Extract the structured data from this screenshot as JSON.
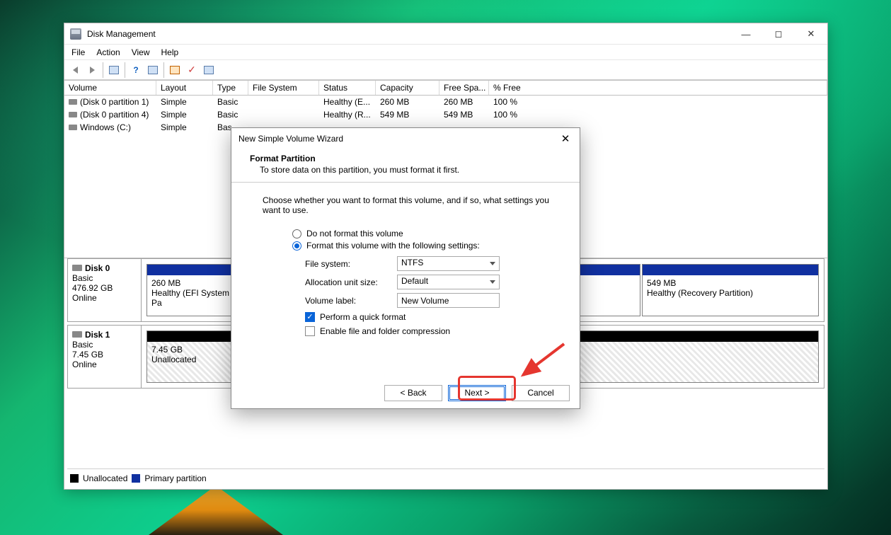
{
  "window": {
    "title": "Disk Management",
    "menu": [
      "File",
      "Action",
      "View",
      "Help"
    ]
  },
  "columns": {
    "c0": "Volume",
    "c1": "Layout",
    "c2": "Type",
    "c3": "File System",
    "c4": "Status",
    "c5": "Capacity",
    "c6": "Free Spa...",
    "c7": "% Free"
  },
  "rows": [
    {
      "vol": "(Disk 0 partition 1)",
      "lay": "Simple",
      "typ": "Basic",
      "fs": "",
      "stat": "Healthy (E...",
      "cap": "260 MB",
      "free": "260 MB",
      "pct": "100 %"
    },
    {
      "vol": "(Disk 0 partition 4)",
      "lay": "Simple",
      "typ": "Basic",
      "fs": "",
      "stat": "Healthy (R...",
      "cap": "549 MB",
      "free": "549 MB",
      "pct": "100 %"
    },
    {
      "vol": "Windows (C:)",
      "lay": "Simple",
      "typ": "Bas",
      "fs": "",
      "stat": "",
      "cap": "",
      "free": "",
      "pct": ""
    }
  ],
  "disk0": {
    "name": "Disk 0",
    "type": "Basic",
    "size": "476.92 GB",
    "status": "Online",
    "p1": {
      "size": "260 MB",
      "stat": "Healthy (EFI System Pa"
    },
    "p4": {
      "size": "549 MB",
      "stat": "Healthy (Recovery Partition)"
    }
  },
  "disk1": {
    "name": "Disk 1",
    "type": "Basic",
    "size": "7.45 GB",
    "status": "Online",
    "p1": {
      "size": "7.45 GB",
      "stat": "Unallocated"
    }
  },
  "legend": {
    "unalloc": "Unallocated",
    "primary": "Primary partition"
  },
  "dialog": {
    "title": "New Simple Volume Wizard",
    "heading": "Format Partition",
    "subheading": "To store data on this partition, you must format it first.",
    "instruction": "Choose whether you want to format this volume, and if so, what settings you want to use.",
    "opt1": "Do not format this volume",
    "opt2": "Format this volume with the following settings:",
    "fs_label": "File system:",
    "fs_value": "NTFS",
    "au_label": "Allocation unit size:",
    "au_value": "Default",
    "vl_label": "Volume label:",
    "vl_value": "New Volume",
    "chk1": "Perform a quick format",
    "chk2": "Enable file and folder compression",
    "back": "< Back",
    "next": "Next >",
    "cancel": "Cancel"
  }
}
